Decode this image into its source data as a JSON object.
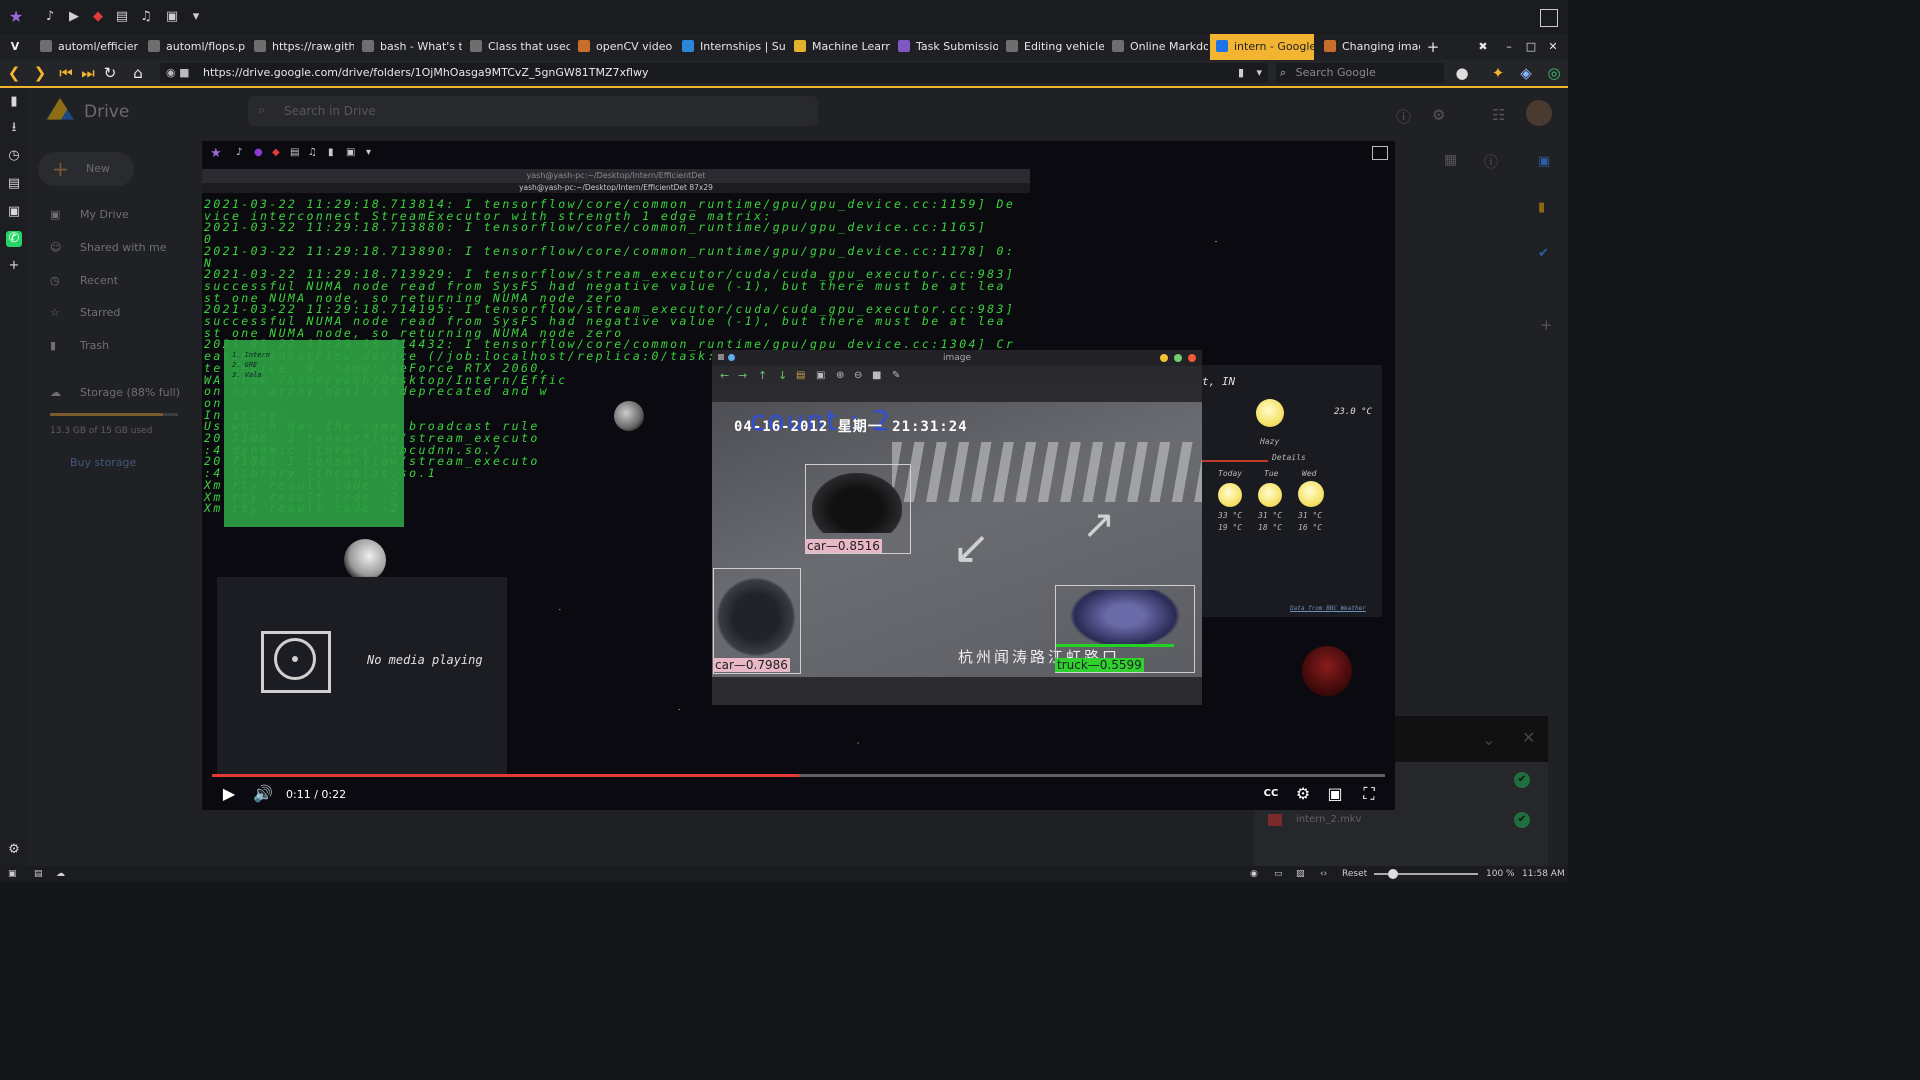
{
  "browser": {
    "tabs": [
      {
        "label": "automl/efficientd",
        "color": "#6e6e6e"
      },
      {
        "label": "automl/flops.png",
        "color": "#6e6e6e"
      },
      {
        "label": "https://raw.githul",
        "color": "#6e6e6e"
      },
      {
        "label": "bash - What's the",
        "color": "#6e6e6e"
      },
      {
        "label": "Class that used in",
        "color": "#6e6e6e"
      },
      {
        "label": "openCV video sav",
        "color": "#c96e2a"
      },
      {
        "label": "Internships | Sum",
        "color": "#2b88d8"
      },
      {
        "label": "Machine Learning",
        "color": "#e4b12a"
      },
      {
        "label": "Task Submission F",
        "color": "#7e57c2"
      },
      {
        "label": "Editing vehicle_cc",
        "color": "#6e6e6e"
      },
      {
        "label": "Online Markdown",
        "color": "#6e6e6e"
      },
      {
        "label": "intern - Google Di",
        "color": "#1a73e8"
      },
      {
        "label": "Changing image s",
        "color": "#c96e2a"
      }
    ],
    "url": "https://drive.google.com/drive/folders/1OjMhOasga9MTCvZ_5gnGW81TMZ7xflwy",
    "search_placeholder": "Search Google"
  },
  "drive": {
    "logo_text": "Drive",
    "search_placeholder": "Search in Drive",
    "new_button": "New",
    "nav": [
      "My Drive",
      "Shared with me",
      "Recent",
      "Starred",
      "Trash"
    ],
    "storage_label": "Storage (88% full)",
    "storage_used": "13.3 GB of 15 GB used",
    "storage_fraction": 0.88,
    "buy_storage": "Buy storage",
    "upload_file": "intern_2.mkv"
  },
  "video": {
    "time": "0:11 / 0:22",
    "progress_fraction": 0.5,
    "terminal": {
      "title1": "yash@yash-pc:~/Desktop/Intern/EfficientDet",
      "title2": "yash@yash-pc:~/Desktop/Intern/EfficientDet 87x29",
      "lines": [
        "2021-03-22 11:29:18.713814: I tensorflow/core/common_runtime/gpu/gpu_device.cc:1159] De",
        "vice interconnect StreamExecutor with strength 1 edge matrix:",
        "2021-03-22 11:29:18.713880: I tensorflow/core/common_runtime/gpu/gpu_device.cc:1165]",
        "0",
        "2021-03-22 11:29:18.713890: I tensorflow/core/common_runtime/gpu/gpu_device.cc:1178] 0:",
        "N",
        "2021-03-22 11:29:18.713929: I tensorflow/stream_executor/cuda/cuda_gpu_executor.cc:983]",
        "successful NUMA node read from SysFS had negative value (-1), but there must be at lea",
        "st one NUMA node, so returning NUMA node zero",
        "2021-03-22 11:29:18.714195: I tensorflow/stream_executor/cuda/cuda_gpu_executor.cc:983]",
        "successful NUMA node read from SysFS had negative value (-1), but there must be at lea",
        "st one NUMA node, so returning NUMA node zero",
        "2021-03-22 11:29:18.714432: I tensorflow/core/common_runtime/gpu/gpu_device.cc:1304] Cr",
        "eated TensorFlow device (/job:localhost/replica:0/task:0",
        "te                         device: 0, name: GeForce RTX 2060,",
        "WA                        from /home/yash/Desktop/Intern/Effic",
        "on                        ops.array_ops) is deprecated and w",
        "on",
        "In                       sting:",
        "Us                        which has the same broadcast rule",
        "20                        7108: I tensorflow/stream_executo",
        ":4                        dynamic library libcudnn.so.7",
        "20                        7186: I tensorflow/stream_executo",
        ":4                        library libcublas.so.1",
        "Xm                        rty result code -2",
        "Xm                        rty result code -2",
        "Xm                        rty result code -2"
      ]
    },
    "sticky_note": [
      "1. Intern",
      "2. GRE",
      "3. Vala"
    ],
    "media_text": "No media playing",
    "image_window_title": "image",
    "overlay": {
      "count": "count : 2",
      "datetime": "04-16-2012 星期一 21:31:24",
      "location_text": "杭州闻涛路江虹路口"
    },
    "detections": [
      {
        "label": "car—0.8516"
      },
      {
        "label": "car—0.7986"
      },
      {
        "label": "truck—0.5599"
      }
    ],
    "weather": {
      "place": "t, IN",
      "temp": "23.0 °C",
      "condition": "Hazy",
      "details": "Details",
      "days": [
        {
          "day": "Today",
          "high": "33 °C",
          "low": "19 °C"
        },
        {
          "day": "Tue",
          "high": "31 °C",
          "low": "18 °C"
        },
        {
          "day": "Wed",
          "high": "31 °C",
          "low": "16 °C"
        }
      ],
      "source": "Data from BBC Weather"
    }
  },
  "statusbar": {
    "reset": "Reset",
    "zoom": "100 %",
    "time": "11:58 AM"
  },
  "colors": {
    "accent": "#f3b431",
    "terminal_green": "#3dd23d",
    "progress": "#e53935"
  }
}
